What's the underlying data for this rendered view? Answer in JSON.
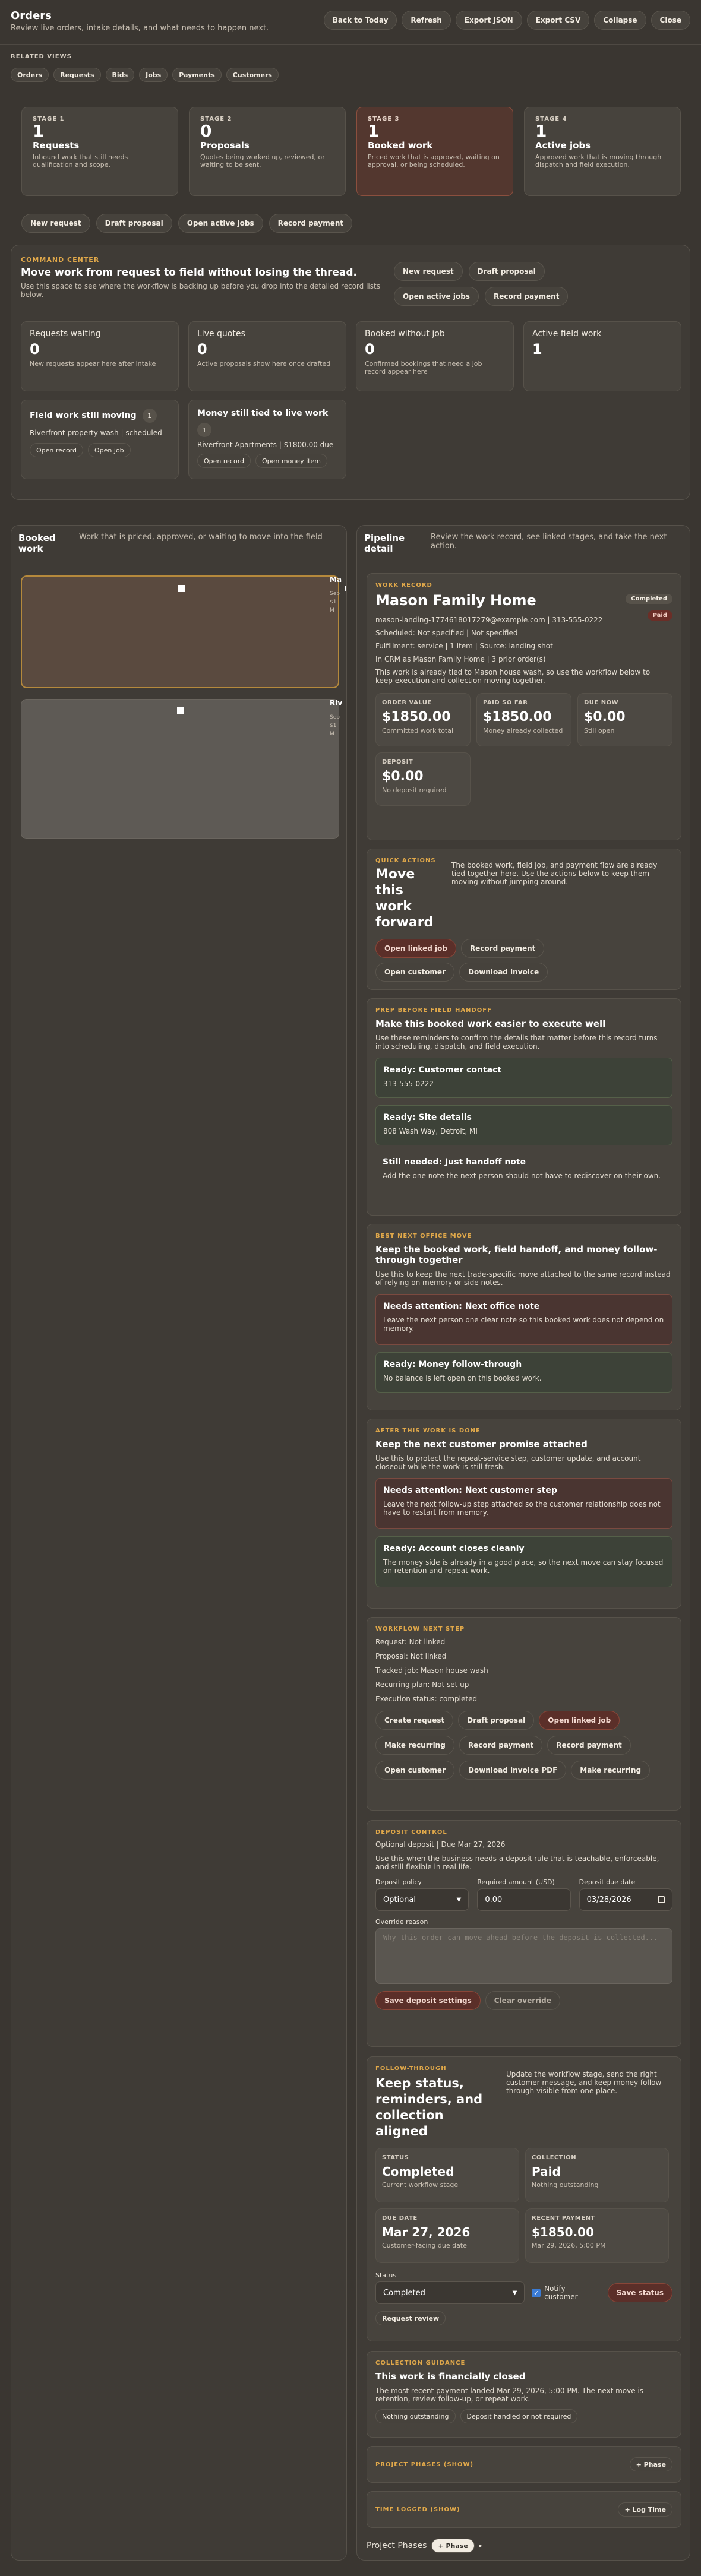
{
  "header": {
    "title": "Orders",
    "subtitle": "Review live orders, intake details, and what needs to happen next.",
    "buttons": [
      "Back to Today",
      "Refresh",
      "Export JSON",
      "Export CSV",
      "Collapse",
      "Close"
    ]
  },
  "related": {
    "label": "RELATED VIEWS",
    "items": [
      "Orders",
      "Requests",
      "Bids",
      "Jobs",
      "Payments",
      "Customers"
    ]
  },
  "stages": [
    {
      "eyebrow": "STAGE 1",
      "count": "1",
      "title": "Requests",
      "desc": "Inbound work that still needs qualification and scope."
    },
    {
      "eyebrow": "STAGE 2",
      "count": "0",
      "title": "Proposals",
      "desc": "Quotes being worked up, reviewed, or waiting to be sent."
    },
    {
      "eyebrow": "STAGE 3",
      "count": "1",
      "title": "Booked work",
      "desc": "Priced work that is approved, waiting on approval, or being scheduled."
    },
    {
      "eyebrow": "STAGE 4",
      "count": "1",
      "title": "Active jobs",
      "desc": "Approved work that is moving through dispatch and field execution."
    }
  ],
  "quick_actions": [
    "New request",
    "Draft proposal",
    "Open active jobs",
    "Record payment"
  ],
  "command": {
    "eyebrow": "COMMAND CENTER",
    "title": "Move work from request to field without losing the thread.",
    "desc": "Use this space to see where the workflow is backing up before you drop into the detailed record lists below.",
    "buttons": [
      "New request",
      "Draft proposal",
      "Open active jobs",
      "Record payment"
    ],
    "stats": [
      {
        "label": "Requests waiting",
        "value": "0",
        "note": "New requests appear here after intake"
      },
      {
        "label": "Live quotes",
        "value": "0",
        "note": "Active proposals show here once drafted"
      },
      {
        "label": "Booked without job",
        "value": "0",
        "note": "Confirmed bookings that need a job record appear here"
      },
      {
        "label": "Active field work",
        "value": "1",
        "note": ""
      }
    ],
    "field_moving": {
      "title": "Field work still moving",
      "badge": "1",
      "line": "Riverfront property wash | scheduled",
      "buttons": [
        "Open record",
        "Open job"
      ]
    },
    "money_not_live": {
      "title": "Money still tied to live work",
      "badge": "1",
      "line": "Riverfront Apartments | $1800.00 due",
      "buttons": [
        "Open record",
        "Open money item"
      ]
    }
  },
  "booked": {
    "title": "Booked work",
    "desc": "Work that is priced, approved, or waiting to move into the field",
    "cards": [
      {
        "title": "Ma",
        "meta": [
          "Sep",
          "$1",
          "M"
        ]
      },
      {
        "title": "Riv",
        "meta": [
          "Sep",
          "$1",
          "M"
        ]
      }
    ]
  },
  "pipeline": {
    "title": "Pipeline detail",
    "desc": "Review the work record, see linked stages, and take the next action."
  },
  "record": {
    "eyebrow": "WORK RECORD",
    "name": "Mason Family Home",
    "badge_status": "Completed",
    "badge_paid": "Paid",
    "lines": [
      "mason-landing-1774618017279@example.com | 313-555-0222",
      "Scheduled: Not specified | Not specified",
      "Fulfillment: service | 1 item | Source: landing shot",
      "In CRM as Mason Family Home | 3 prior order(s)"
    ],
    "tie": "This work is already tied to Mason house wash, so use the workflow below to keep execution and collection moving together.",
    "stats": [
      {
        "label": "ORDER VALUE",
        "value": "$1850.00",
        "note": "Committed work total"
      },
      {
        "label": "PAID SO FAR",
        "value": "$1850.00",
        "note": "Money already collected"
      },
      {
        "label": "DUE NOW",
        "value": "$0.00",
        "note": "Still open"
      },
      {
        "label": "DEPOSIT",
        "value": "$0.00",
        "note": "No deposit required"
      }
    ]
  },
  "qa": {
    "eyebrow": "QUICK ACTIONS",
    "title": "Move this work forward",
    "desc": "The booked work, field job, and payment flow are already tied together here. Use the actions below to keep them moving without jumping around.",
    "buttons": [
      "Open linked job",
      "Record payment",
      "Open customer",
      "Download invoice"
    ]
  },
  "prep": {
    "eyebrow": "PREP BEFORE FIELD HANDOFF",
    "title": "Make this booked work easier to execute well",
    "desc": "Use these reminders to confirm the details that matter before this record turns into scheduling, dispatch, and field execution.",
    "items": [
      {
        "title": "Ready: Customer contact",
        "text": "313-555-0222",
        "kind": "green"
      },
      {
        "title": "Ready: Site details",
        "text": "808 Wash Way, Detroit, MI",
        "kind": "green"
      },
      {
        "title": "Still needed: Just handoff note",
        "text": "Add the one note the next person should not have to rediscover on their own.",
        "kind": "plain"
      }
    ]
  },
  "best": {
    "eyebrow": "BEST NEXT OFFICE MOVE",
    "title": "Keep the booked work, field handoff, and money follow-through together",
    "desc": "Use this to keep the next trade-specific move attached to the same record instead of relying on memory or side notes.",
    "items": [
      {
        "title": "Needs attention: Next office note",
        "text": "Leave the next person one clear note so this booked work does not depend on memory.",
        "kind": "red"
      },
      {
        "title": "Ready: Money follow-through",
        "text": "No balance is left open on this booked work.",
        "kind": "green"
      }
    ]
  },
  "after": {
    "eyebrow": "AFTER THIS WORK IS DONE",
    "title": "Keep the next customer promise attached",
    "desc": "Use this to protect the repeat-service step, customer update, and account closeout while the work is still fresh.",
    "items": [
      {
        "title": "Needs attention: Next customer step",
        "text": "Leave the next follow-up step attached so the customer relationship does not have to restart from memory.",
        "kind": "red"
      },
      {
        "title": "Ready: Account closes cleanly",
        "text": "The money side is already in a good place, so the next move can stay focused on retention and repeat work.",
        "kind": "green"
      }
    ]
  },
  "workflow": {
    "eyebrow": "WORKFLOW NEXT STEP",
    "lines": [
      "Request: Not linked",
      "Proposal: Not linked",
      "Tracked job: Mason house wash",
      "Recurring plan: Not set up",
      "Execution status: completed"
    ],
    "buttons": [
      "Create request",
      "Draft proposal",
      "Open linked job",
      "Make recurring",
      "Record payment",
      "Record payment",
      "Open customer",
      "Download invoice PDF",
      "Make recurring"
    ]
  },
  "deposit": {
    "eyebrow": "DEPOSIT CONTROL",
    "line": "Optional deposit | Due Mar 27, 2026",
    "desc": "Use this when the business needs a deposit rule that is teachable, enforceable, and still flexible in real life.",
    "policy_label": "Deposit policy",
    "policy_value": "Optional",
    "amount_label": "Required amount (USD)",
    "amount_value": "0.00",
    "due_label": "Deposit due date",
    "due_value": "03/28/2026",
    "override_label": "Override reason",
    "override_placeholder": "Why this order can move ahead before the deposit is collected...",
    "buttons": [
      "Save deposit settings",
      "Clear override"
    ]
  },
  "follow": {
    "eyebrow": "FOLLOW-THROUGH",
    "title": "Keep status, reminders, and collection aligned",
    "desc": "Update the workflow stage, send the right customer message, and keep money follow-through visible from one place.",
    "stats": [
      {
        "label": "STATUS",
        "value": "Completed",
        "note": "Current workflow stage"
      },
      {
        "label": "COLLECTION",
        "value": "Paid",
        "note": "Nothing outstanding"
      },
      {
        "label": "DUE DATE",
        "value": "Mar 27, 2026",
        "note": "Customer-facing due date"
      },
      {
        "label": "RECENT PAYMENT",
        "value": "$1850.00",
        "note": "Mar 29, 2026, 5:00 PM"
      }
    ],
    "status_label": "Status",
    "status_value": "Completed",
    "notify": "Notify customer",
    "save": "Save status",
    "review": "Request review"
  },
  "guidance": {
    "eyebrow": "COLLECTION GUIDANCE",
    "title": "This work is financially closed",
    "desc": "The most recent payment landed Mar 29, 2026, 5:00 PM. The next move is retention, review follow-up, or repeat work.",
    "tags": [
      "Nothing outstanding",
      "Deposit handled or not required"
    ]
  },
  "phases": {
    "label": "PROJECT PHASES (SHOW)",
    "button": "+ Phase"
  },
  "time": {
    "label": "TIME LOGGED (SHOW)",
    "button": "+ Log Time"
  },
  "phases_footer": {
    "label": "Project Phases",
    "button": "+ Phase"
  },
  "colors": {
    "accent": "#e0a84a",
    "bg": "#3a3631"
  }
}
